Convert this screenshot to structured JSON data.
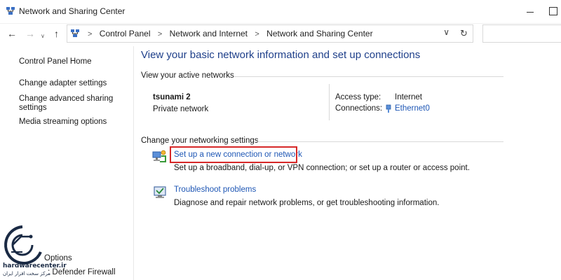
{
  "window": {
    "title": "Network and Sharing Center"
  },
  "address_bar": {
    "crumbs": [
      "Control Panel",
      "Network and Internet",
      "Network and Sharing Center"
    ],
    "separator": ">",
    "back_glyph": "←",
    "forward_glyph": "→",
    "recent_glyph": "∨",
    "up_glyph": "↑",
    "dropdown_glyph": "∨",
    "refresh_glyph": "↻"
  },
  "sidebar": {
    "home": "Control Panel Home",
    "links": [
      "Change adapter settings",
      "Change advanced sharing",
      "settings",
      "Media streaming options"
    ],
    "see_also": [
      "Options",
      ": Defender Firewall"
    ]
  },
  "main": {
    "title": "View your basic network information and set up connections",
    "active_networks": {
      "header": "View your active networks",
      "name": "tsunami 2",
      "category": "Private network",
      "access_type_label": "Access type:",
      "access_type_value": "Internet",
      "connections_label": "Connections:",
      "connections_value": "Ethernet0"
    },
    "settings": {
      "header": "Change your networking settings",
      "tasks": [
        {
          "link": "Set up a new connection or network",
          "description": "Set up a broadband, dial-up, or VPN connection; or set up a router or access point.",
          "icon": "network-setup-icon"
        },
        {
          "link": "Troubleshoot problems",
          "description": "Diagnose and repair network problems, or get troubleshooting information.",
          "icon": "troubleshoot-icon"
        }
      ]
    }
  },
  "watermark": {
    "line1": "hardwarecenter.ir",
    "line2": "مرکز سخت افزار ایران"
  },
  "colors": {
    "link": "#1f57b5",
    "title": "#1e3f8a",
    "highlight": "#d62828",
    "logo": "#1a2a44"
  }
}
